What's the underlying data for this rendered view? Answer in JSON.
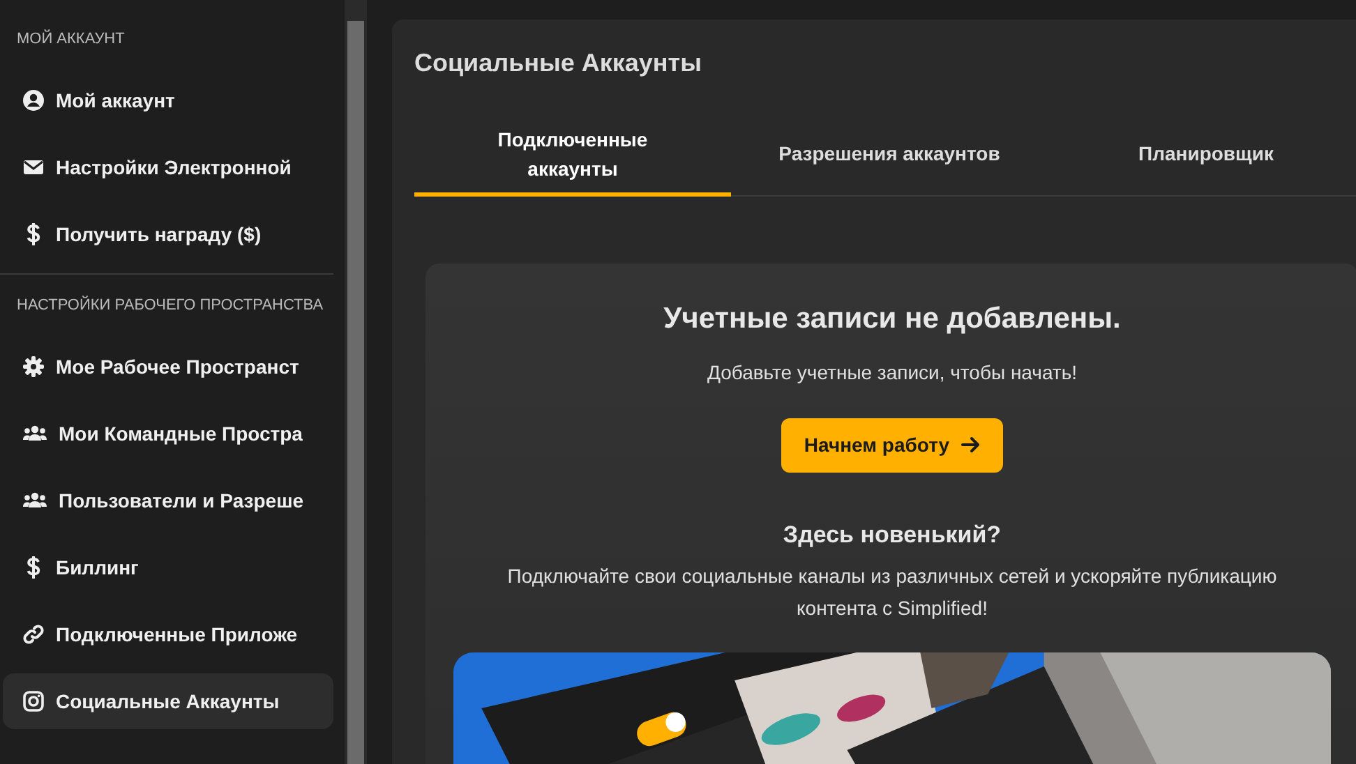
{
  "sidebar": {
    "sections": [
      {
        "title": "МОЙ АККАУНТ",
        "items": [
          {
            "label": "Мой аккаунт",
            "selected": false
          },
          {
            "label": "Настройки Электронной",
            "selected": false
          },
          {
            "label": "Получить награду ($)",
            "selected": false
          }
        ]
      },
      {
        "title": "НАСТРОЙКИ РАБОЧЕГО ПРОСТРАНСТВА",
        "items": [
          {
            "label": "Мое Рабочее Пространст",
            "selected": false
          },
          {
            "label": "Мои Командные Простра",
            "selected": false
          },
          {
            "label": "Пользователи и Разреше",
            "selected": false
          },
          {
            "label": "Биллинг",
            "selected": false
          },
          {
            "label": "Подключенные Приложе",
            "selected": false
          },
          {
            "label": "Социальные Аккаунты",
            "selected": true
          }
        ]
      }
    ]
  },
  "main": {
    "title": "Социальные Аккаунты",
    "tabs": [
      {
        "label": "Подключенные аккаунты",
        "selected": true
      },
      {
        "label": "Разрешения аккаунтов",
        "selected": false
      },
      {
        "label": "Планировщик",
        "selected": false
      }
    ],
    "empty_state": {
      "heading": "Учетные записи не добавлены.",
      "text": "Добавьте учетные записи, чтобы начать!",
      "button": "Начнем работу"
    },
    "intro": {
      "heading": "Здесь новенький?",
      "text": "Подключайте свои социальные каналы из различных сетей и ускоряйте публикацию контента с Simplified!"
    }
  }
}
